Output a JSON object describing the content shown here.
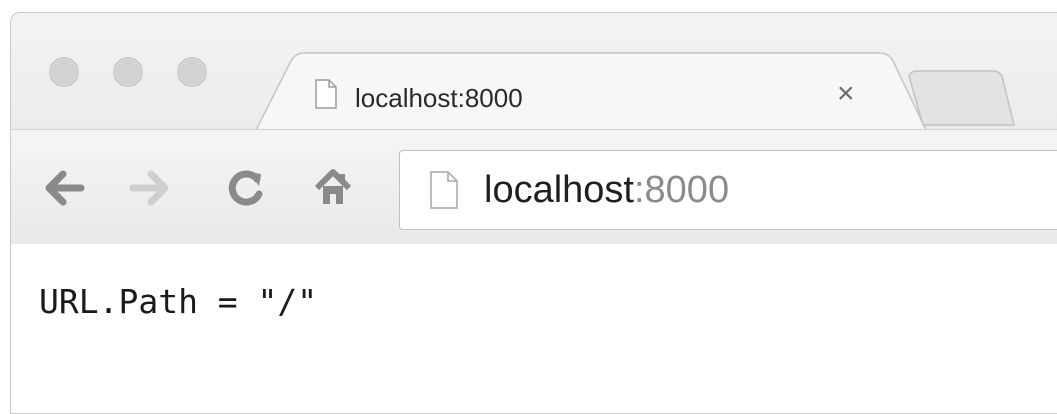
{
  "tab": {
    "title": "localhost:8000",
    "close_glyph": "×"
  },
  "toolbar": {
    "back_icon": "back-arrow-icon",
    "forward_icon": "forward-arrow-icon",
    "reload_icon": "reload-icon",
    "home_icon": "home-icon"
  },
  "address_bar": {
    "host": "localhost",
    "port": ":8000"
  },
  "page": {
    "body_text": "URL.Path = \"/\""
  },
  "colors": {
    "window_chrome": "#ececec",
    "traffic_light": "#d3d3d3",
    "icon_gray": "#8a8a8a",
    "icon_light": "#cfcfcf"
  }
}
